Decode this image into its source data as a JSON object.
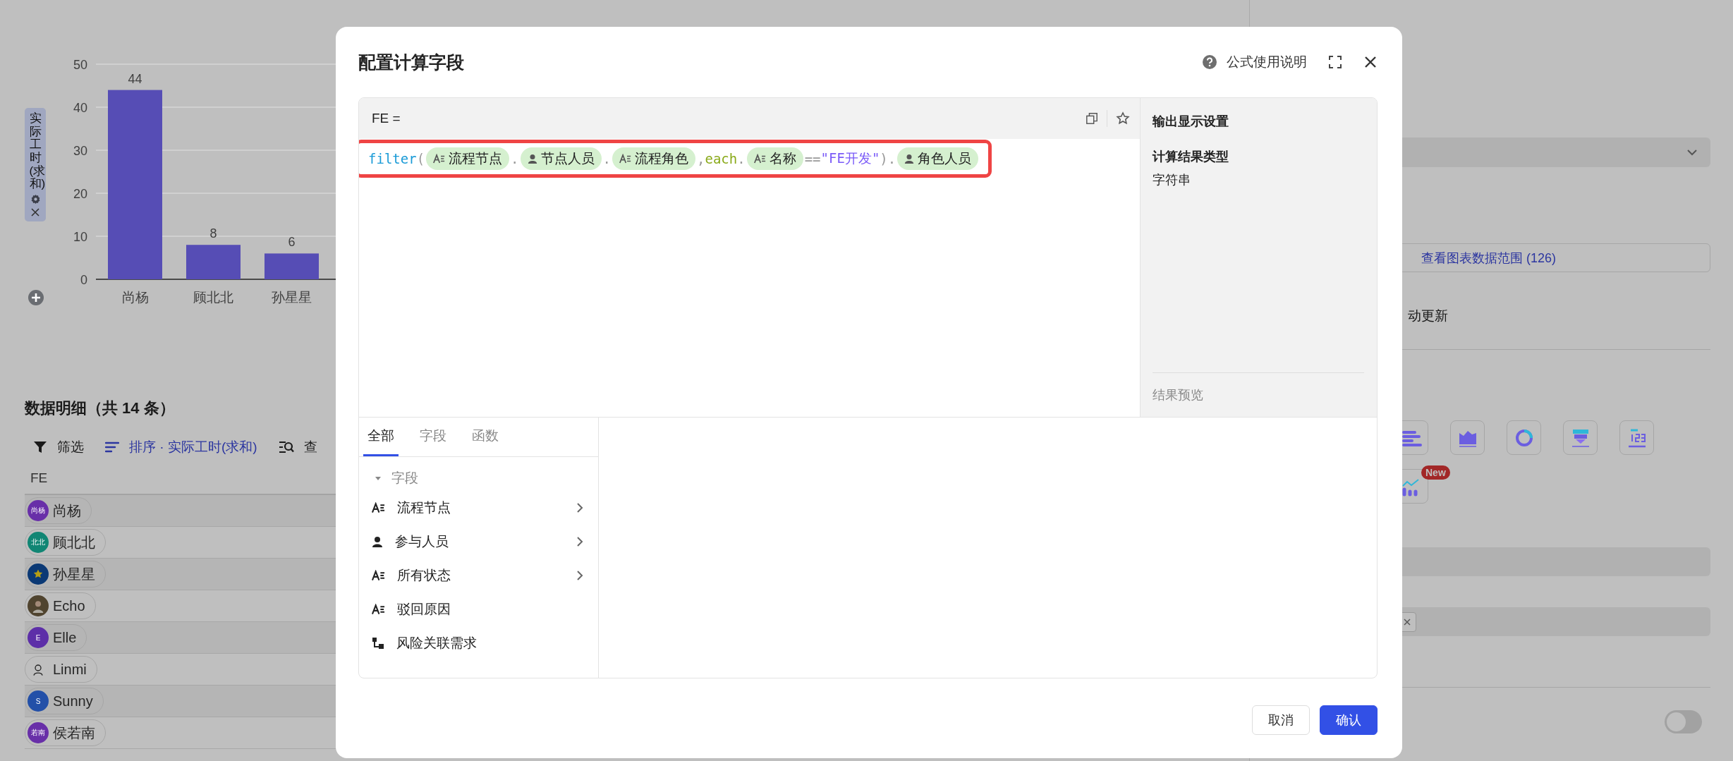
{
  "chart": {
    "chart_data": {
      "type": "bar",
      "ylabel": "实际工时(求和)",
      "categories": [
        "尚杨",
        "顾北北",
        "孙星星"
      ],
      "series": [
        {
          "color": "#564db5",
          "values": [
            44,
            8,
            6
          ]
        }
      ],
      "ylim": [
        0,
        50
      ],
      "yticks": [
        0,
        10,
        20,
        30,
        40,
        50
      ],
      "grid": true,
      "data_labels": true
    }
  },
  "details": {
    "title": "数据明细（共 14 条）",
    "toolbar": [
      {
        "kind": "filter",
        "label": "筛选",
        "active": false
      },
      {
        "kind": "sort",
        "label": "排序 · 实际工时(求和)",
        "active": true
      },
      {
        "kind": "search",
        "label": "查",
        "active": false
      }
    ],
    "column": "FE",
    "rows": [
      {
        "name": "尚杨",
        "kind": "initials",
        "avatar_text": "尚杨",
        "color": "#682fa8"
      },
      {
        "name": "顾北北",
        "kind": "initials",
        "avatar_text": "北北",
        "color": "#118674"
      },
      {
        "name": "孙星星",
        "kind": "star",
        "color": "#0b3975"
      },
      {
        "name": "Echo",
        "kind": "photo",
        "color": "#50442f"
      },
      {
        "name": "Elle",
        "kind": "initials",
        "avatar_text": "E",
        "color": "#5d2fa8"
      },
      {
        "name": "Linmi",
        "kind": "figure",
        "color": "#bfbfbf"
      },
      {
        "name": "Sunny",
        "kind": "initials",
        "avatar_text": "S",
        "color": "#2350a8"
      },
      {
        "name": "侯若南",
        "kind": "initials",
        "avatar_text": "若南",
        "color": "#682fa8"
      }
    ]
  },
  "sidebar": {
    "range_button": "查看图表数据范围 (126)",
    "auto_update_label": "动更新",
    "new_badge": "New",
    "toggle": {
      "on": false
    }
  },
  "dialog": {
    "title": "配置计算字段",
    "help_link": "公式使用说明",
    "field_name": "FE =",
    "formula_highlighted": true,
    "formula": [
      {
        "kind": "function",
        "text": "filter"
      },
      {
        "kind": "punct",
        "text": "("
      },
      {
        "kind": "text_field",
        "text": "流程节点"
      },
      {
        "kind": "punct",
        "text": "."
      },
      {
        "kind": "person_field",
        "text": "节点人员"
      },
      {
        "kind": "punct",
        "text": "."
      },
      {
        "kind": "text_field",
        "text": "流程角色"
      },
      {
        "kind": "punct",
        "text": ","
      },
      {
        "kind": "keyword",
        "text": "each"
      },
      {
        "kind": "punct",
        "text": "."
      },
      {
        "kind": "text_field",
        "text": "名称"
      },
      {
        "kind": "punct",
        "text": "=="
      },
      {
        "kind": "string",
        "text": "\"FE开发\""
      },
      {
        "kind": "punct",
        "text": ")."
      },
      {
        "kind": "person_field",
        "text": "角色人员"
      }
    ],
    "output": {
      "heading": "输出显示设置",
      "type_label": "计算结果类型",
      "type_value": "字符串",
      "preview_label": "结果预览"
    },
    "tabs": [
      {
        "label": "全部",
        "selected": true
      },
      {
        "label": "字段",
        "selected": false
      },
      {
        "label": "函数",
        "selected": false
      }
    ],
    "group": {
      "label": "字段",
      "expanded": true,
      "items": [
        {
          "label": "流程节点",
          "kind": "text",
          "has_children": true
        },
        {
          "label": "参与人员",
          "kind": "person",
          "has_children": true
        },
        {
          "label": "所有状态",
          "kind": "text",
          "has_children": true
        },
        {
          "label": "驳回原因",
          "kind": "text",
          "has_children": false
        },
        {
          "label": "风险关联需求",
          "kind": "relation",
          "has_children": false
        }
      ]
    },
    "buttons": {
      "cancel": "取消",
      "confirm": "确认"
    }
  }
}
